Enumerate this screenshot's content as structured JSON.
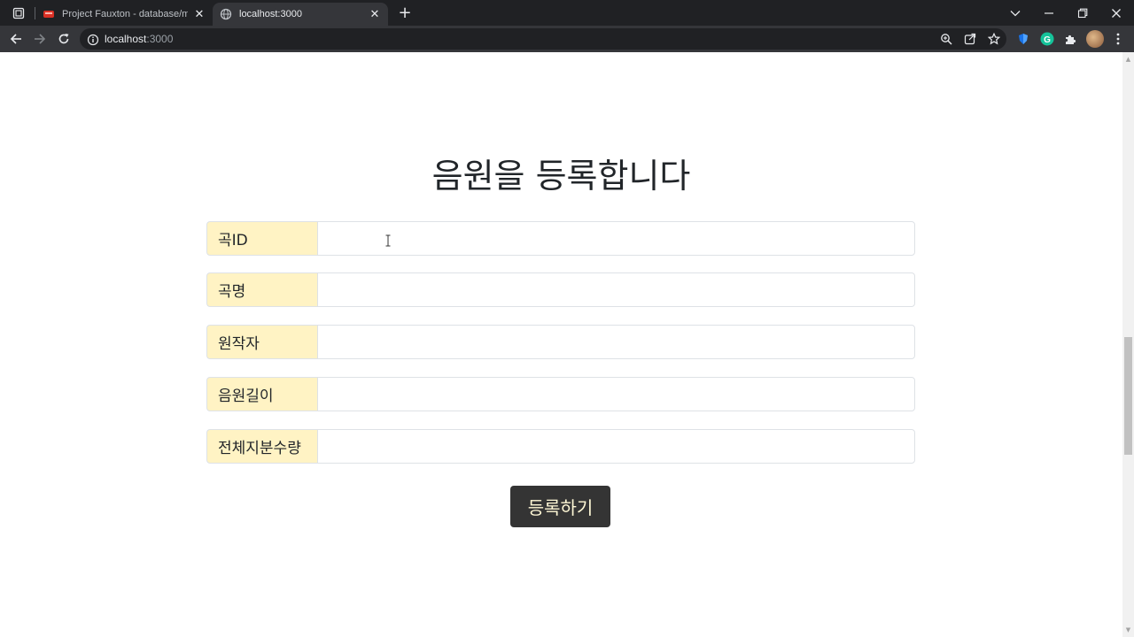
{
  "browser": {
    "tabs": [
      {
        "title": "Project Fauxton - database/msh",
        "active": false,
        "favicon": "fauxton-logo-icon"
      },
      {
        "title": "localhost:3000",
        "active": true,
        "favicon": "globe-icon"
      }
    ],
    "new_tab_glyph": "+",
    "close_glyph": "✕",
    "url": {
      "host": "localhost",
      "port": ":3000"
    },
    "accent_colors": {
      "tab_strip": "#202124",
      "toolbar": "#35363a",
      "fauxton_red": "#d93025"
    }
  },
  "page": {
    "title": "음원을 등록합니다",
    "fields": [
      {
        "label": "곡ID",
        "value": "",
        "placeholder": ""
      },
      {
        "label": "곡명",
        "value": "",
        "placeholder": ""
      },
      {
        "label": "원작자",
        "value": "",
        "placeholder": ""
      },
      {
        "label": "음원길이",
        "value": "",
        "placeholder": ""
      },
      {
        "label": "전체지분수량",
        "value": "",
        "placeholder": ""
      }
    ],
    "submit_label": "등록하기",
    "colors": {
      "label_bg": "#fff3c4",
      "button_bg": "#343434",
      "button_text": "#fff8d6"
    }
  }
}
